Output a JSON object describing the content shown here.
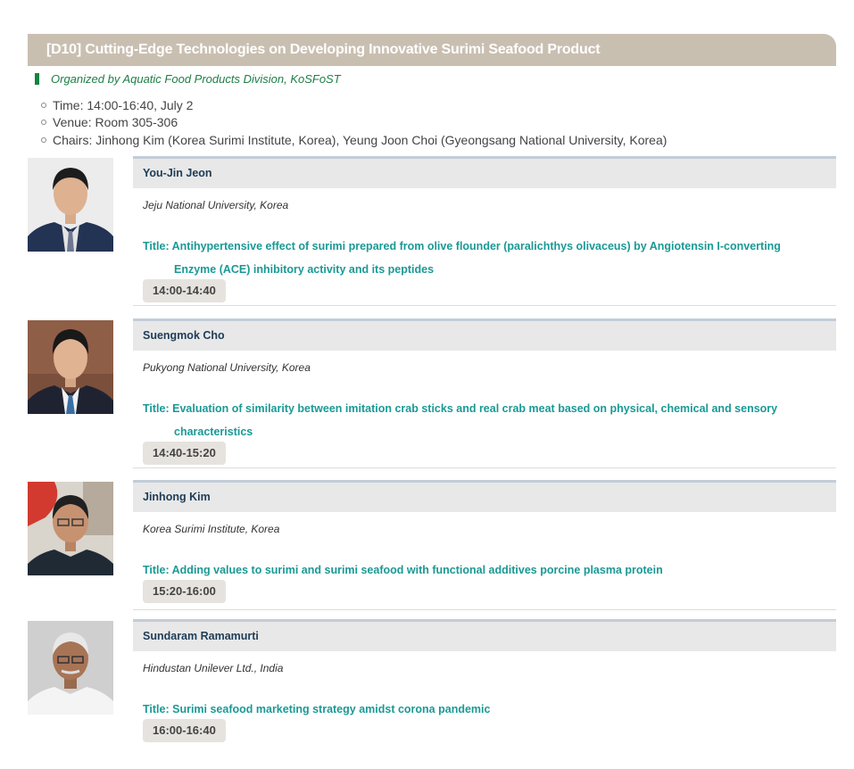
{
  "session": {
    "title": "[D10] Cutting-Edge Technologies on Developing Innovative Surimi Seafood Product",
    "organizer": "Organized by Aquatic Food Products Division, KoSFoST",
    "time": "Time: 14:00-16:40, July 2",
    "venue": "Venue: Room 305-306",
    "chairs": "Chairs: Jinhong Kim (Korea Surimi Institute, Korea), Yeung Joon Choi (Gyeongsang National University, Korea)"
  },
  "talks": [
    {
      "speaker": "You-Jin Jeon",
      "affiliation": "Jeju National University, Korea",
      "title_line1": "Title: Antihypertensive effect of surimi prepared from olive flounder (paralichthys olivaceus) by Angiotensin I-converting",
      "title_line2": "Enzyme (ACE) inhibitory activity and its peptides",
      "time": "14:00-14:40"
    },
    {
      "speaker": "Suengmok Cho",
      "affiliation": "Pukyong National University, Korea",
      "title_line1": "Title: Evaluation of similarity between imitation crab sticks and real crab meat based on physical, chemical and sensory",
      "title_line2": "characteristics",
      "time": "14:40-15:20"
    },
    {
      "speaker": "Jinhong Kim",
      "affiliation": "Korea Surimi Institute, Korea",
      "title_line1": "Title: Adding values to surimi and surimi seafood with functional additives porcine plasma protein",
      "title_line2": "",
      "time": "15:20-16:00"
    },
    {
      "speaker": "Sundaram Ramamurti",
      "affiliation": "Hindustan Unilever Ltd., India",
      "title_line1": "Title: Surimi seafood marketing strategy amidst corona pandemic",
      "title_line2": "",
      "time": "16:00-16:40"
    }
  ],
  "colors": {
    "header_bg": "#c9bfb1",
    "organizer_green": "#1d7f45",
    "speaker_name": "#1e3c57",
    "title_teal": "#1a9995",
    "time_badge_bg": "#e6e3df"
  }
}
